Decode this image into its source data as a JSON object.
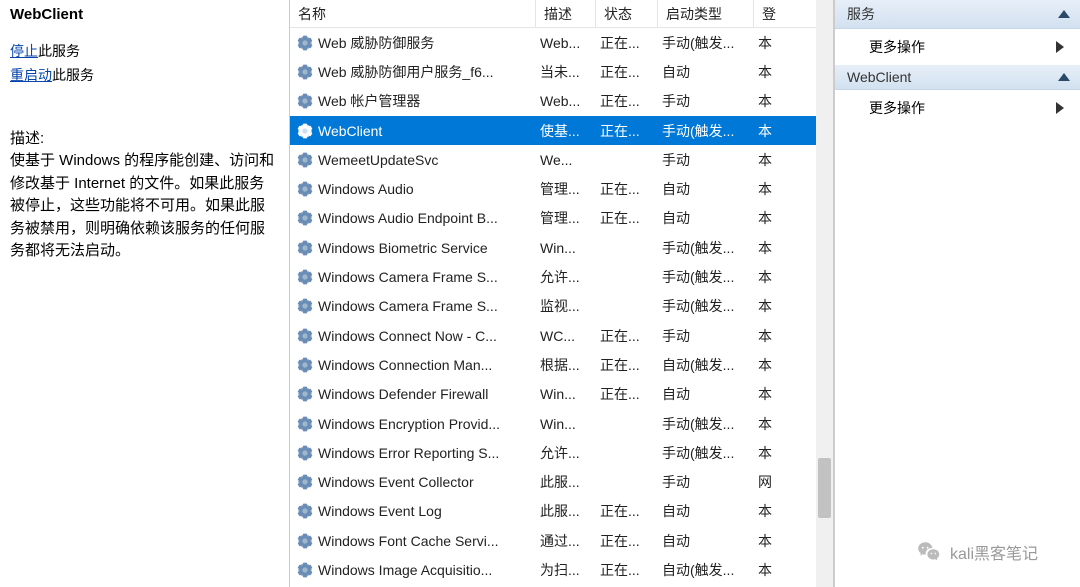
{
  "detail": {
    "title": "WebClient",
    "stop_link": "停止",
    "stop_suffix": "此服务",
    "restart_link": "重启动",
    "restart_suffix": "此服务",
    "desc_label": "描述:",
    "desc_body": "使基于 Windows 的程序能创建、访问和修改基于 Internet 的文件。如果此服务被停止，这些功能将不可用。如果此服务被禁用，则明确依赖该服务的任何服务都将无法启动。"
  },
  "columns": {
    "name": "名称",
    "desc": "描述",
    "status": "状态",
    "startup": "启动类型",
    "logon": "登"
  },
  "services": [
    {
      "name": "Web 威胁防御服务",
      "desc": "Web...",
      "status": "正在...",
      "startup": "手动(触发...",
      "logon": "本"
    },
    {
      "name": "Web 威胁防御用户服务_f6...",
      "desc": "当未...",
      "status": "正在...",
      "startup": "自动",
      "logon": "本"
    },
    {
      "name": "Web 帐户管理器",
      "desc": "Web...",
      "status": "正在...",
      "startup": "手动",
      "logon": "本"
    },
    {
      "name": "WebClient",
      "desc": "使基...",
      "status": "正在...",
      "startup": "手动(触发...",
      "logon": "本",
      "selected": true
    },
    {
      "name": "WemeetUpdateSvc",
      "desc": "We...",
      "status": "",
      "startup": "手动",
      "logon": "本"
    },
    {
      "name": "Windows Audio",
      "desc": "管理...",
      "status": "正在...",
      "startup": "自动",
      "logon": "本"
    },
    {
      "name": "Windows Audio Endpoint B...",
      "desc": "管理...",
      "status": "正在...",
      "startup": "自动",
      "logon": "本"
    },
    {
      "name": "Windows Biometric Service",
      "desc": "Win...",
      "status": "",
      "startup": "手动(触发...",
      "logon": "本"
    },
    {
      "name": "Windows Camera Frame S...",
      "desc": "允许...",
      "status": "",
      "startup": "手动(触发...",
      "logon": "本"
    },
    {
      "name": "Windows Camera Frame S...",
      "desc": "监视...",
      "status": "",
      "startup": "手动(触发...",
      "logon": "本"
    },
    {
      "name": "Windows Connect Now - C...",
      "desc": "WC...",
      "status": "正在...",
      "startup": "手动",
      "logon": "本"
    },
    {
      "name": "Windows Connection Man...",
      "desc": "根据...",
      "status": "正在...",
      "startup": "自动(触发...",
      "logon": "本"
    },
    {
      "name": "Windows Defender Firewall",
      "desc": "Win...",
      "status": "正在...",
      "startup": "自动",
      "logon": "本"
    },
    {
      "name": "Windows Encryption Provid...",
      "desc": "Win...",
      "status": "",
      "startup": "手动(触发...",
      "logon": "本"
    },
    {
      "name": "Windows Error Reporting S...",
      "desc": "允许...",
      "status": "",
      "startup": "手动(触发...",
      "logon": "本"
    },
    {
      "name": "Windows Event Collector",
      "desc": "此服...",
      "status": "",
      "startup": "手动",
      "logon": "网"
    },
    {
      "name": "Windows Event Log",
      "desc": "此服...",
      "status": "正在...",
      "startup": "自动",
      "logon": "本"
    },
    {
      "name": "Windows Font Cache Servi...",
      "desc": "通过...",
      "status": "正在...",
      "startup": "自动",
      "logon": "本"
    },
    {
      "name": "Windows Image Acquisitio...",
      "desc": "为扫...",
      "status": "正在...",
      "startup": "自动(触发...",
      "logon": "本"
    }
  ],
  "actions_pane": {
    "section1_title": "服务",
    "section1_item": "更多操作",
    "section2_title": "WebClient",
    "section2_item": "更多操作"
  },
  "watermark": "kali黑客笔记"
}
